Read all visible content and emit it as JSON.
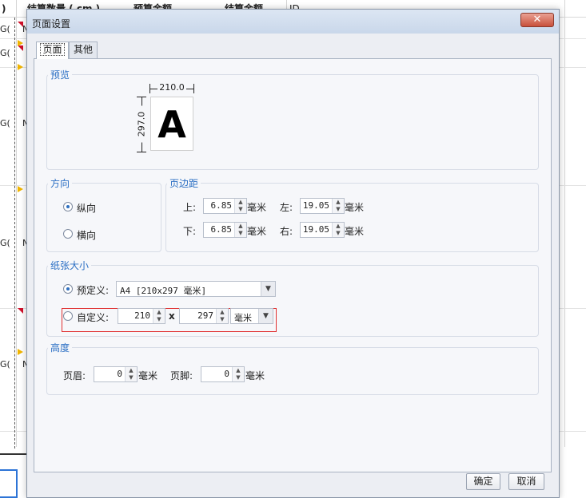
{
  "background": {
    "columns": [
      ")",
      "结算数量 ( cm )",
      "预算金额",
      "结算金额",
      "ID"
    ],
    "row_markers": [
      "G(",
      "G(",
      "G(",
      "G(",
      "G("
    ],
    "row_suffix": "N"
  },
  "dialog": {
    "title": "页面设置",
    "close_icon": "x-close-icon",
    "tabs": [
      {
        "label": "页面",
        "active": true
      },
      {
        "label": "其他",
        "active": false
      }
    ],
    "preview": {
      "label": "预览",
      "width": "210.0",
      "height": "297.0",
      "sample_glyph": "A"
    },
    "orientation": {
      "label": "方向",
      "options": [
        {
          "label": "纵向",
          "selected": true
        },
        {
          "label": "横向",
          "selected": false
        }
      ]
    },
    "margins": {
      "label": "页边距",
      "top_label": "上:",
      "top_value": "6.85",
      "left_label": "左:",
      "left_value": "19.05",
      "bottom_label": "下:",
      "bottom_value": "6.85",
      "right_label": "右:",
      "right_value": "19.05",
      "unit": "毫米"
    },
    "paper_size": {
      "label": "纸张大小",
      "predefined_label": "预定义:",
      "predefined_value": "A4 [210x297 毫米]",
      "predefined_selected": true,
      "custom_label": "自定义:",
      "custom_width": "210",
      "custom_sep": "x",
      "custom_height": "297",
      "custom_unit": "毫米"
    },
    "height": {
      "label": "高度",
      "header_label": "页眉:",
      "header_value": "0",
      "footer_label": "页脚:",
      "footer_value": "0",
      "unit": "毫米"
    },
    "buttons": {
      "ok": "确定",
      "cancel": "取消"
    }
  }
}
